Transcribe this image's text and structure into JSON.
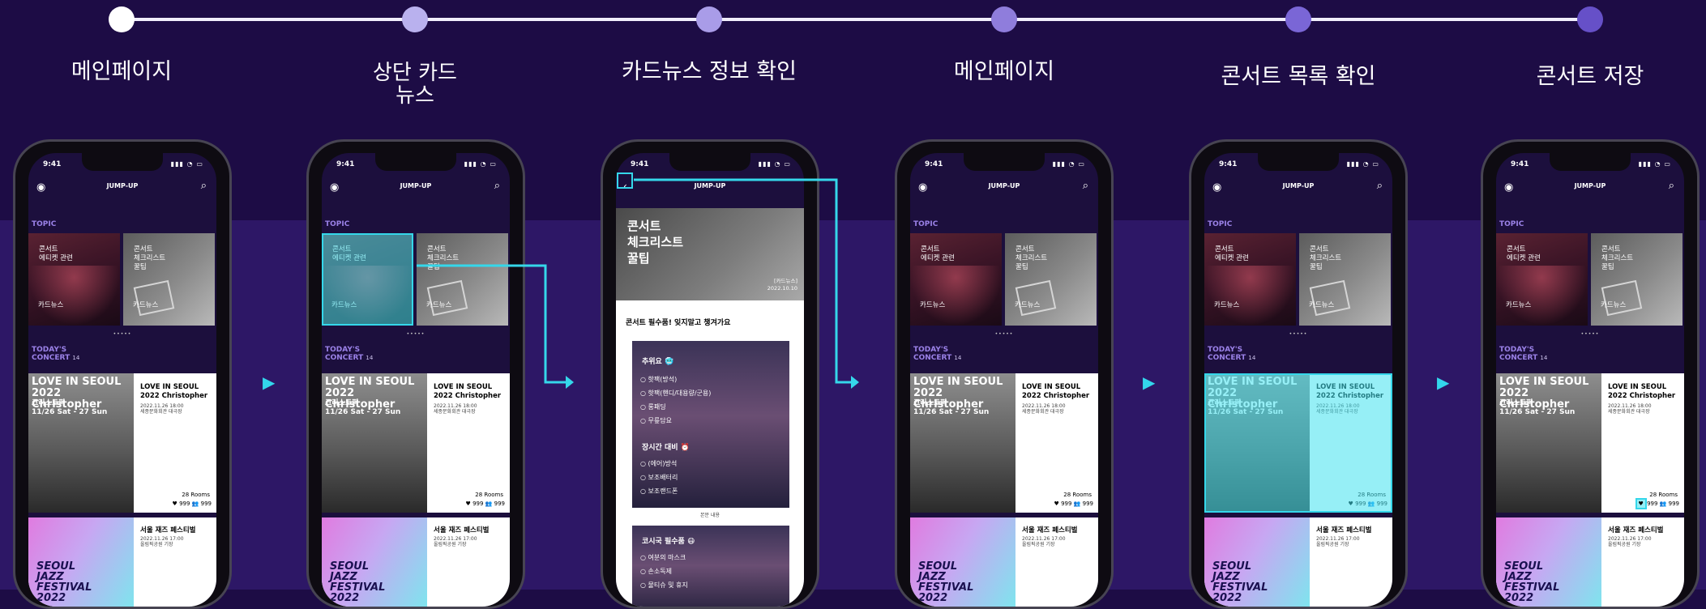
{
  "steps": [
    {
      "label": "메인페이지"
    },
    {
      "label": "상단 카드\n뉴스"
    },
    {
      "label": "카드뉴스 정보 확인"
    },
    {
      "label": "메인페이지"
    },
    {
      "label": "콘서트 목록 확인"
    },
    {
      "label": "콘서트 저장"
    }
  ],
  "colors": {
    "background": "#1d0c45",
    "band": "#2d1766",
    "highlight": "#35d7ea",
    "dots": [
      "#ffffff",
      "#b9b1ee",
      "#a99ce8",
      "#8f7ddc",
      "#7a66d6",
      "#6650c8"
    ]
  },
  "phone": {
    "time": "9:41",
    "app_title": "JUMP-UP",
    "profile_icon": "profile-icon",
    "search_icon": "search-icon",
    "topic_label": "TOPIC",
    "topic_cards": [
      {
        "title": "콘서트\n에티켓 관련",
        "tag": "카드뉴스"
      },
      {
        "title": "콘서트\n체크리스트\n꿀팁",
        "tag": "카드뉴스"
      }
    ],
    "page_dots": "•••••",
    "today_label": "TODAY'S\nCONCERT",
    "today_count": "14",
    "concert1": {
      "poster_head": "LOVE IN SEOUL 2022 Christopher",
      "poster_sub": "크리스토퍼\n11/26 Sat - 27 Sun",
      "name": "LOVE IN SEOUL\n2022 Christopher",
      "date": "2022.11.26 18:00",
      "venue": "세종문화회관 대극장",
      "rooms": "28 Rooms",
      "likes": "999",
      "people": "999"
    },
    "concert2": {
      "poster_text": "SEOUL\nJAZZ\nFESTIVAL\n2022",
      "name": "서울 재즈 페스티벌",
      "date": "2022.11.26 17:00",
      "venue": "올림픽공원 기장"
    }
  },
  "cardnews": {
    "title": "콘서트\n체크리스트\n꿀팁",
    "source": "[카드뉴스]",
    "date": "2022.10.10",
    "lead": "콘서트 필수품! 잊지말고 챙겨가요",
    "section1_title": "추위요 🥶",
    "section1_items": [
      "핫팩(방석)",
      "핫팩(핸디/대용량/군용)",
      "롱패딩",
      "무릎담요"
    ],
    "section2_title": "장시간 대비 ⏰",
    "section2_items": [
      "(에어)방석",
      "보조배터리",
      "보조랜드폰"
    ],
    "caption": "본문 내용",
    "section3_title": "코시국 필수품 😷",
    "section3_items": [
      "여분의 마스크",
      "손소독제",
      "물티슈 및 휴지"
    ]
  },
  "arrow_glyph": "▶"
}
